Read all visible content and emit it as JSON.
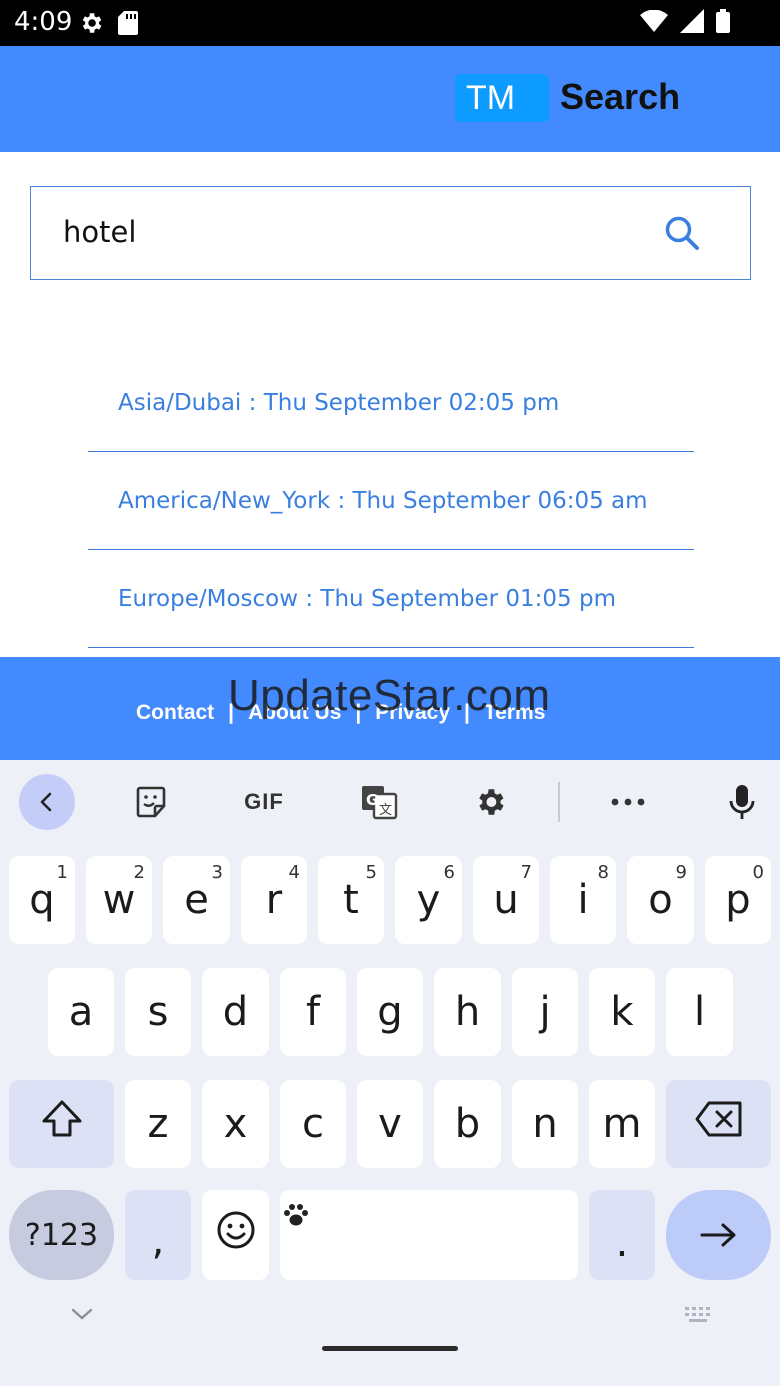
{
  "status_bar": {
    "time": "4:09",
    "icons": [
      "gear-icon",
      "sd-card-icon",
      "wifi-icon",
      "signal-icon",
      "battery-icon"
    ]
  },
  "header": {
    "badge": "TM",
    "title": "Search"
  },
  "search": {
    "value": "hotel",
    "icon": "search-icon"
  },
  "results": [
    {
      "text": "Asia/Dubai : Thu September 02:05 pm"
    },
    {
      "text": "America/New_York : Thu September 06:05 am"
    },
    {
      "text": "Europe/Moscow : Thu September 01:05 pm"
    }
  ],
  "footer": {
    "links": [
      "Contact",
      "About Us",
      "Privacy",
      "Terms"
    ],
    "separator": "|",
    "watermark": "UpdateStar.com"
  },
  "keyboard": {
    "toolbar": [
      "back-chevron-icon",
      "sticker-icon",
      "GIF",
      "translate-icon",
      "settings-icon",
      "more-icon",
      "microphone-icon"
    ],
    "row1": [
      {
        "key": "q",
        "hint": "1"
      },
      {
        "key": "w",
        "hint": "2"
      },
      {
        "key": "e",
        "hint": "3"
      },
      {
        "key": "r",
        "hint": "4"
      },
      {
        "key": "t",
        "hint": "5"
      },
      {
        "key": "y",
        "hint": "6"
      },
      {
        "key": "u",
        "hint": "7"
      },
      {
        "key": "i",
        "hint": "8"
      },
      {
        "key": "o",
        "hint": "9"
      },
      {
        "key": "p",
        "hint": "0"
      }
    ],
    "row2": [
      "a",
      "s",
      "d",
      "f",
      "g",
      "h",
      "j",
      "k",
      "l"
    ],
    "row3": [
      "z",
      "x",
      "c",
      "v",
      "b",
      "n",
      "m"
    ],
    "symbols_label": "?123",
    "comma": ",",
    "period": ".",
    "colors": {
      "background": "#eef0f8",
      "key": "#ffffff",
      "modifier": "#dde1f5",
      "enter": "#bdcbf9"
    }
  },
  "colors": {
    "header": "#448aff",
    "badge": "#0d9bff",
    "result_text": "#3a7fe0",
    "search_border": "#4a86d6"
  }
}
